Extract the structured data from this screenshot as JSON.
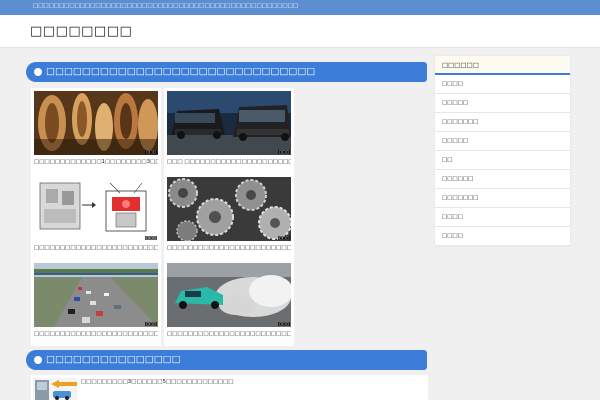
{
  "topbar": {
    "text": "□□□□□□□□□□□□□□□□□□□□□□□□□□□□□□□□□□□□□□□□□□□□□□□□□□□"
  },
  "header": {
    "site_title": "□□□□□□□□"
  },
  "sections": {
    "featured": {
      "title": "□□□□□□□□□□□□□□□□□□□□□□□□□□□□□□"
    },
    "latest": {
      "title": "□□□□□□□□□□□□□□□"
    }
  },
  "cards": [
    {
      "caption": "□□□□□□□□□□□□□1□□□□□□□□3□□□□□□□□",
      "badge": "□□□",
      "image": "engine-parts-image"
    },
    {
      "caption": "□□□ □□□□□□□□□□□□□□□□□□□□□□□□□□",
      "badge": "□□□",
      "image": "minivan-night-image"
    },
    {
      "caption": "□□□□□□□□□□□□□□□□□□□□□□□□□□□□□□□□□",
      "badge": "□□□",
      "image": "engine-diagram-image"
    },
    {
      "caption": "□□□□□□□□□□□□□□□□□□□□□□□□□□□□□□□□□□□□□□□□",
      "badge": "□□□",
      "image": "gears-image"
    },
    {
      "caption": "□□□□□□□□□□□□□□□□□□□□□□□□□□□□□□□□□□□□□…",
      "badge": "□□□",
      "image": "highway-traffic-image"
    },
    {
      "caption": "□□□□□□□□□□□□□□□□□□□□□□□□□□□□□□□□□□□□□□□□□□",
      "badge": "□□□",
      "image": "drift-car-image"
    }
  ],
  "latest_items": [
    {
      "text": "□□□□□□□□□3□□□□□□5□□□□□□□□□□□□□",
      "image": "exchange-thumbnail"
    }
  ],
  "sidebar": {
    "title": "□□□□□□",
    "categories": [
      "□□□□",
      "□□□□□",
      "□□□□□□□",
      "□□□□□",
      "□□",
      "□□□□□□",
      "□□□□□□□",
      "□□□□",
      "□□□□"
    ]
  },
  "colors": {
    "accent": "#3b7dd8",
    "topbar": "#5c8ed1",
    "background": "#f0f0f0"
  }
}
